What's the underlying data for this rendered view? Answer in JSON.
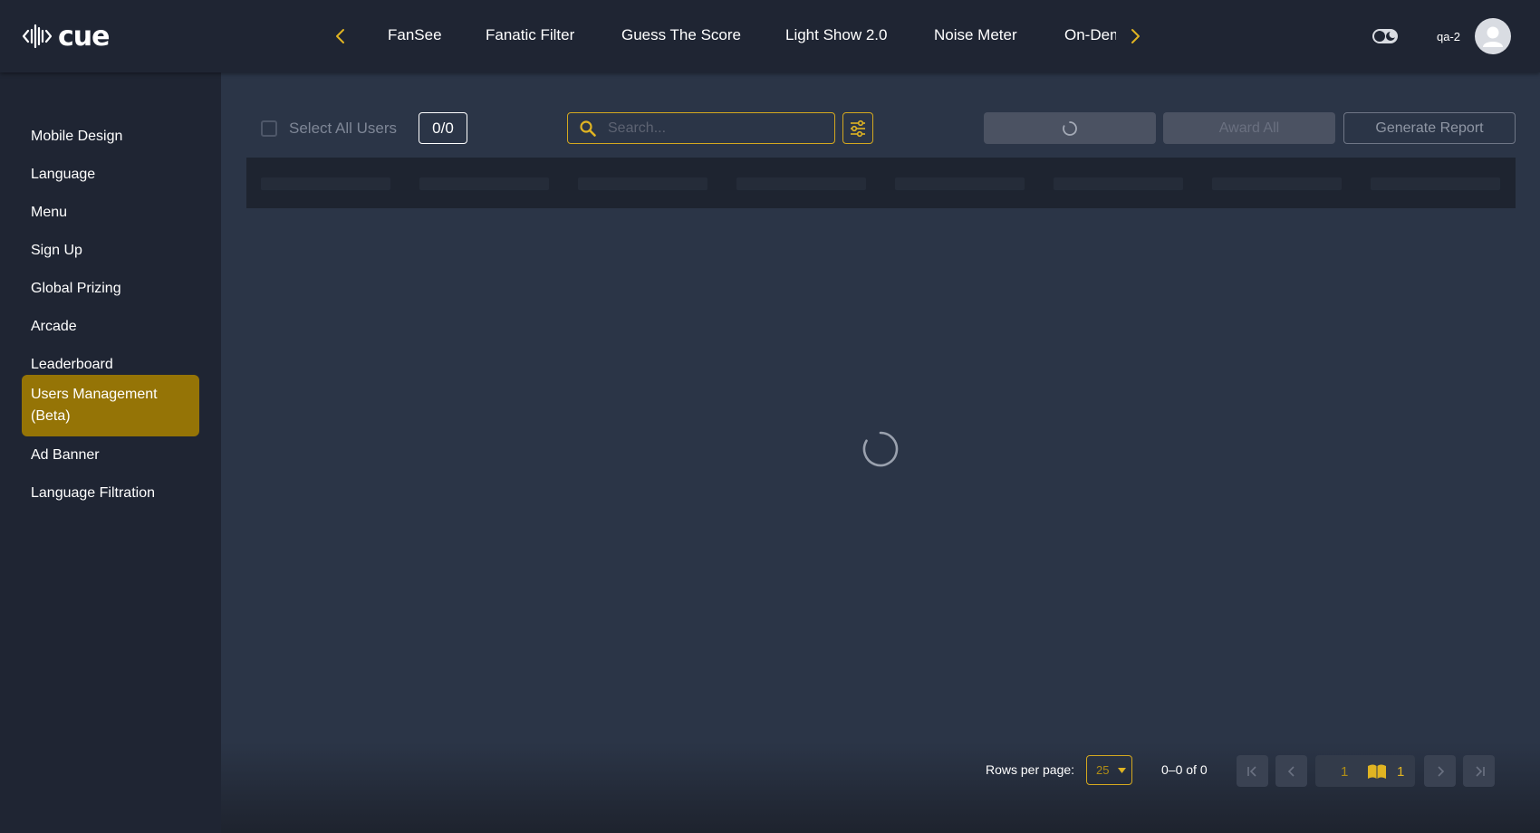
{
  "brand": {
    "name": "cue"
  },
  "topnav": {
    "items": [
      {
        "label": "FanSee"
      },
      {
        "label": "Fanatic Filter"
      },
      {
        "label": "Guess The Score"
      },
      {
        "label": "Light Show 2.0"
      },
      {
        "label": "Noise Meter"
      },
      {
        "label": "On-Demand"
      }
    ]
  },
  "user": {
    "name": "qa-2"
  },
  "sidebar": {
    "items": [
      {
        "label": "Mobile Design"
      },
      {
        "label": "Language"
      },
      {
        "label": "Menu"
      },
      {
        "label": "Sign Up"
      },
      {
        "label": "Global Prizing"
      },
      {
        "label": "Arcade"
      },
      {
        "label": "Leaderboard"
      },
      {
        "label": "Users Management (Beta)",
        "active": true
      },
      {
        "label": "Ad Banner"
      },
      {
        "label": "Language Filtration"
      }
    ]
  },
  "toolbar": {
    "select_all_label": "Select All Users",
    "selected_count": "0/0",
    "search_placeholder": "Search...",
    "award_all_label": "Award All",
    "generate_report_label": "Generate Report"
  },
  "pagination": {
    "rows_per_page_label": "Rows per page:",
    "rows_per_page_value": "25",
    "range_text": "0–0 of 0",
    "current_page": "1",
    "total_pages": "1"
  },
  "colors": {
    "accent": "#d4a81f",
    "active_sidebar": "#957406",
    "background": "#1f2533",
    "content_background": "#2b3547"
  },
  "icons": [
    "logo-icon",
    "chevron-left-icon",
    "chevron-right-icon",
    "theme-toggle-icon",
    "user-avatar-icon",
    "search-icon",
    "filter-sliders-icon",
    "spinner-icon",
    "caret-down-icon",
    "first-page-icon",
    "previous-page-icon",
    "book-icon",
    "next-page-icon",
    "last-page-icon"
  ]
}
